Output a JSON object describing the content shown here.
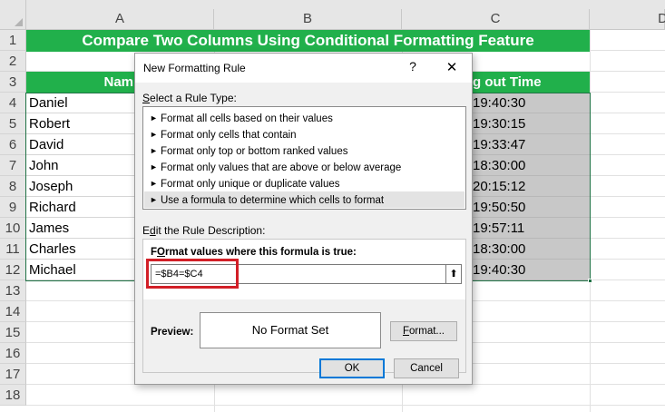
{
  "sheet": {
    "columns": [
      "A",
      "B",
      "C",
      "D"
    ],
    "rows": [
      "1",
      "2",
      "3",
      "4",
      "5",
      "6",
      "7",
      "8",
      "9",
      "10",
      "11",
      "12",
      "13",
      "14",
      "15",
      "16",
      "17",
      "18"
    ],
    "title": "Compare Two Columns Using Conditional Formatting Feature",
    "header_name_partial": "Nam",
    "header_time_partial": "g out Time",
    "names": [
      "Daniel",
      "Robert",
      "David",
      "John",
      "Joseph",
      "Richard",
      "James",
      "Charles",
      "Michael"
    ],
    "times_partial": [
      "19:40:30",
      "19:30:15",
      "19:33:47",
      "18:30:00",
      "20:15:12",
      "19:50:50",
      "19:57:11",
      "18:30:00",
      "19:40:30"
    ],
    "colors": {
      "title_green": "#21b04b",
      "selection": "#217346",
      "highlight_gray": "#c8c8c8"
    }
  },
  "dialog": {
    "title": "New Formatting Rule",
    "help": "?",
    "close": "✕",
    "rule_type_label_u": "S",
    "rule_type_label_rest": "elect a Rule Type:",
    "rule_types": [
      "Format all cells based on their values",
      "Format only cells that contain",
      "Format only top or bottom ranked values",
      "Format only values that are above or below average",
      "Format only unique or duplicate values",
      "Use a formula to determine which cells to format"
    ],
    "selected_rule_index": 5,
    "desc_label_pre": "E",
    "desc_label_u": "d",
    "desc_label_rest": "it the Rule Description:",
    "formula_label_u": "O",
    "formula_label_pre": "F",
    "formula_label_rest": "rmat values where this formula is true:",
    "formula_value": "=$B4=$C4",
    "preview_label": "Preview:",
    "preview_text": "No Format Set",
    "format_button_u": "F",
    "format_button_rest": "ormat...",
    "ok_label": "OK",
    "cancel_label": "Cancel",
    "highlight_color": "#d21f27"
  }
}
